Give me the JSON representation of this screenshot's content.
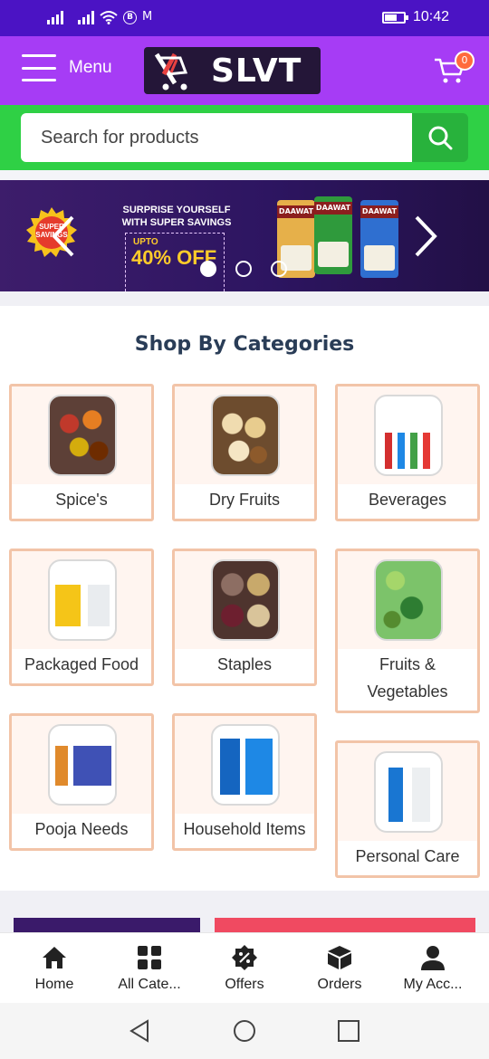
{
  "status_bar": {
    "time": "10:42",
    "icons": [
      "signal-icon",
      "signal-icon",
      "wifi-icon",
      "bluetooth-b-icon",
      "gmail-m-icon",
      "battery-icon"
    ]
  },
  "header": {
    "menu_label": "Menu",
    "logo_text": "SLVT",
    "cart_count": "0"
  },
  "search": {
    "placeholder": "Search for products"
  },
  "banner": {
    "badge_text": "SUPER SAVINGS",
    "headline": "SURPRISE YOURSELF WITH SUPER SAVINGS",
    "upto": "UPTO",
    "offer": "40% OFF",
    "bags": [
      "DAAWAT",
      "DAAWAT",
      "DAAWAT"
    ],
    "dots": 3,
    "active_dot": 0
  },
  "categories": {
    "title": "Shop By Categories",
    "items": [
      {
        "label": "Spice's",
        "icon": "spices-image"
      },
      {
        "label": "Dry Fruits",
        "icon": "dry-fruits-image"
      },
      {
        "label": "Beverages",
        "icon": "beverages-image"
      },
      {
        "label": "Packaged Food",
        "icon": "packaged-food-image"
      },
      {
        "label": "Staples",
        "icon": "staples-image"
      },
      {
        "label": "Fruits & Vegetables",
        "icon": "fruits-vegetables-image"
      },
      {
        "label": "Pooja Needs",
        "icon": "pooja-needs-image"
      },
      {
        "label": "Household Items",
        "icon": "household-items-image"
      },
      {
        "label": "Personal Care",
        "icon": "personal-care-image"
      }
    ]
  },
  "bottom_nav": [
    {
      "label": "Home",
      "icon": "home-icon"
    },
    {
      "label": "All Cate...",
      "icon": "grid-icon"
    },
    {
      "label": "Offers",
      "icon": "percent-badge-icon"
    },
    {
      "label": "Orders",
      "icon": "box-icon"
    },
    {
      "label": "My Acc...",
      "icon": "user-icon"
    }
  ],
  "colors": {
    "status_bar": "#4b13c4",
    "header": "#a63cf5",
    "search_bar": "#2fd045",
    "search_button": "#28b23c",
    "card_border": "#f2c4a8",
    "title": "#2a3d57"
  }
}
